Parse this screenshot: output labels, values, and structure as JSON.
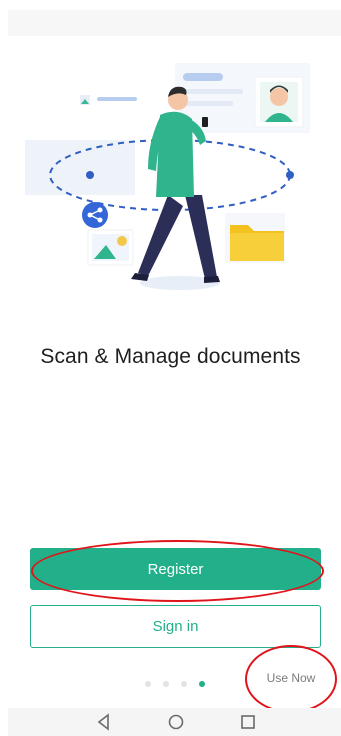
{
  "onboarding": {
    "title": "Scan & Manage documents",
    "register_label": "Register",
    "signin_label": "Sign in",
    "use_now_label": "Use Now",
    "page_indicator": {
      "total": 4,
      "active": 4
    }
  },
  "illustration": {
    "icons": [
      "user-avatar-icon",
      "folder-icon",
      "share-icon",
      "image-icon"
    ]
  },
  "nav": {
    "icons": [
      "back-icon",
      "home-icon",
      "recents-icon"
    ]
  },
  "colors": {
    "accent": "#22b08a",
    "annotation": "#e0141b"
  }
}
